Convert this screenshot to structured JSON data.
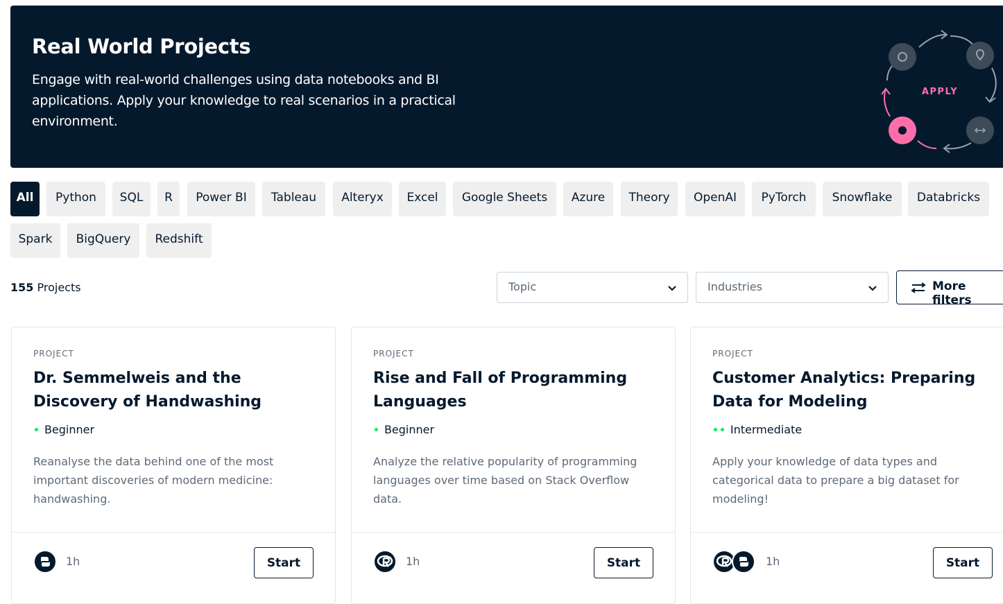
{
  "banner": {
    "title": "Real World Projects",
    "description": "Engage with real-world challenges using data notebooks and BI applications. Apply your knowledge to real scenarios in a practical environment.",
    "graphic_label": "APPLY"
  },
  "filters": {
    "chips": [
      "All",
      "Python",
      "SQL",
      "R",
      "Power BI",
      "Tableau",
      "Alteryx",
      "Excel",
      "Google Sheets",
      "Azure",
      "Theory",
      "OpenAI",
      "PyTorch",
      "Snowflake",
      "Databricks",
      "Spark",
      "BigQuery",
      "Redshift"
    ],
    "active": "All"
  },
  "toolbar": {
    "count_number": "155",
    "count_label": "Projects",
    "topic_placeholder": "Topic",
    "industries_placeholder": "Industries",
    "more_filters_label": "More filters"
  },
  "cards": [
    {
      "kind": "PROJECT",
      "title": "Dr. Semmelweis and the Discovery of Handwashing",
      "level": "Beginner",
      "level_dots": "•",
      "description": "Reanalyse the data behind one of the most important discoveries of modern medicine: handwashing.",
      "technologies": [
        "python-icon"
      ],
      "duration": "1h",
      "cta": "Start"
    },
    {
      "kind": "PROJECT",
      "title": "Rise and Fall of Programming Languages",
      "level": "Beginner",
      "level_dots": "•",
      "description": "Analyze the relative popularity of programming languages over time based on Stack Overflow data.",
      "technologies": [
        "r-icon"
      ],
      "duration": "1h",
      "cta": "Start"
    },
    {
      "kind": "PROJECT",
      "title": "Customer Analytics: Preparing Data for Modeling",
      "level": "Intermediate",
      "level_dots": "••",
      "description": "Apply your knowledge of data types and categorical data to prepare a big dataset for modeling!",
      "technologies": [
        "r-icon",
        "python-icon"
      ],
      "duration": "1h",
      "cta": "Start"
    }
  ],
  "colors": {
    "navy": "#05192d",
    "accent_green": "#03ef62",
    "accent_pink": "#ff6ea9",
    "chip_bg": "#efefef"
  }
}
